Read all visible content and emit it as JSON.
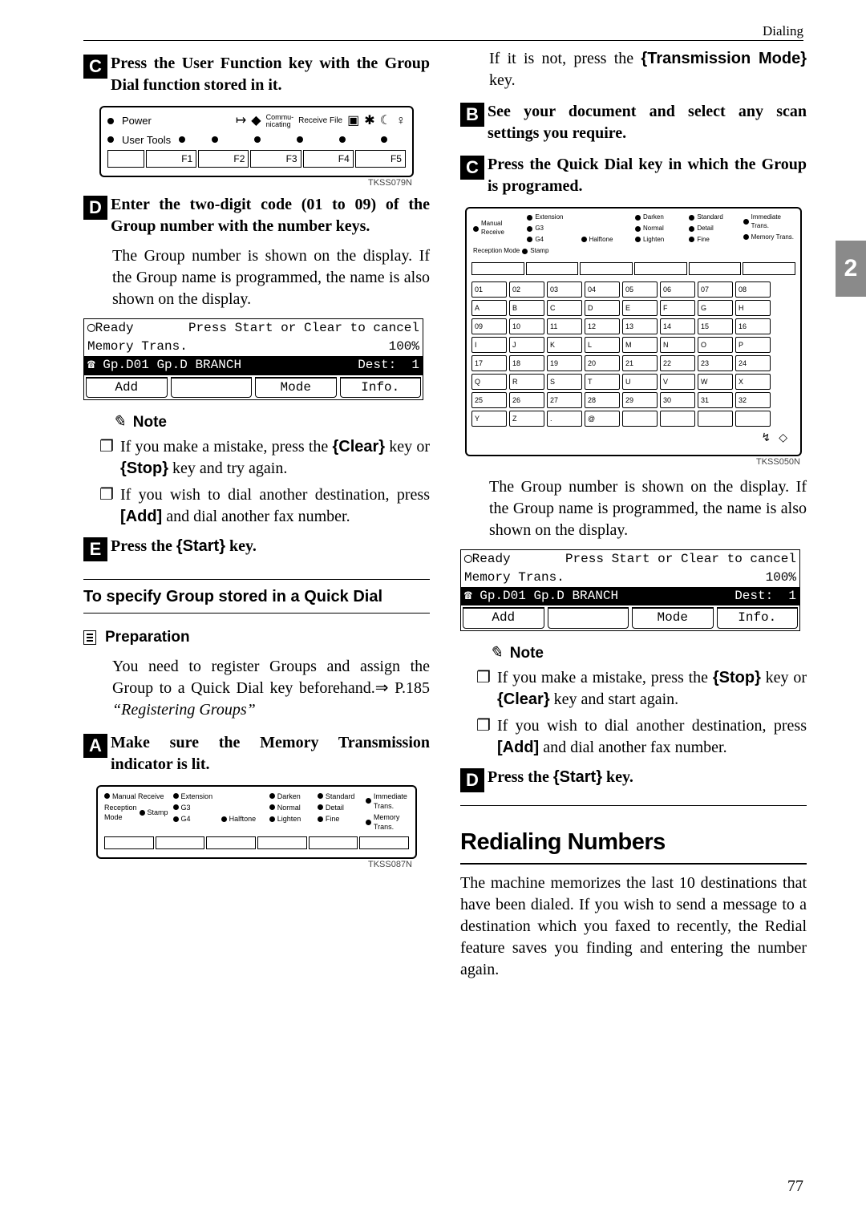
{
  "header": {
    "section": "Dialing"
  },
  "sideTab": "2",
  "pageNumber": "77",
  "left": {
    "step3": {
      "num": "C",
      "text": "Press the User Function key with the Group Dial function stored in it."
    },
    "fig1": {
      "power": "Power",
      "userTools": "User Tools",
      "commu": "Commu-",
      "nicating": "nicating",
      "receive": "Receive File",
      "f1": "F1",
      "f2": "F2",
      "f3": "F3",
      "f4": "F4",
      "f5": "F5",
      "code": "TKSS079N"
    },
    "step4": {
      "num": "D",
      "text": "Enter the two-digit code (01 to 09) of the Group number with the number keys."
    },
    "para1": "The Group number is shown on the display. If the Group name is programmed, the name is also shown on the display.",
    "lcd": {
      "line1a": "Ready",
      "line1b": "Press Start or Clear to cancel",
      "line2a": "Memory Trans.",
      "line2b": "100%",
      "line3a": "Gp.D01 Gp.D BRANCH",
      "line3b": "Dest:  1",
      "btn1": "Add",
      "btn2": "",
      "btn3": "Mode",
      "btn4": "Info."
    },
    "noteHead": "Note",
    "bullets": [
      {
        "pre": "If you make a mistake, press the ",
        "k1": "Clear",
        "mid": " key or ",
        "k2": "Stop",
        "post": " key and try again."
      },
      {
        "pre": "If you wish to dial another destination, press ",
        "k1": "[Add]",
        "post": " and dial another fax number."
      }
    ],
    "step5": {
      "num": "E",
      "pre": "Press the ",
      "key": "Start",
      "post": " key."
    },
    "subhead": "To specify Group stored in a Quick Dial",
    "prepHead": "Preparation",
    "prepBody": {
      "pre": "You need to register Groups and assign the Group to a Quick Dial key beforehand.⇒ P.185 ",
      "ital": "“Registering Groups”"
    },
    "stepA": {
      "num": "A",
      "text": "Make sure the Memory Transmission indicator is lit."
    },
    "fig2": {
      "labels": {
        "manual": "Manual Receive",
        "reception": "Reception Mode",
        "stamp": "Stamp",
        "ext": "Extension",
        "g3": "G3",
        "g4": "G4",
        "halftone": "Halftone",
        "darken": "Darken",
        "normal": "Normal",
        "lighten": "Lighten",
        "standard": "Standard",
        "detail": "Detail",
        "fine": "Fine",
        "immediate": "Immediate",
        "trans": "Trans.",
        "memory": "Memory Trans."
      },
      "code": "TKSS087N"
    }
  },
  "right": {
    "intro": {
      "pre": "If it is not, press the ",
      "key": "Transmission Mode",
      "post": " key."
    },
    "stepB": {
      "num": "B",
      "text": "See your document and select any scan settings you require."
    },
    "stepC": {
      "num": "C",
      "text": "Press the Quick Dial key in which the Group is programed."
    },
    "fig3code": "TKSS050N",
    "dialTop": {
      "manual": "Manual Receive",
      "reception": "Reception Mode",
      "stamp": "Stamp",
      "ext": "Extension",
      "g3": "G3",
      "g4": "G4",
      "halftone": "Halftone",
      "darken": "Darken",
      "normal": "Normal",
      "lighten": "Lighten",
      "standard": "Standard",
      "detail": "Detail",
      "fine": "Fine",
      "immediate": "Immediate",
      "trans": "Trans.",
      "memory": "Memory Trans."
    },
    "dialRows": [
      [
        "01",
        "02",
        "03",
        "04",
        "05",
        "06",
        "07",
        "08"
      ],
      [
        "A",
        "B",
        "C",
        "D",
        "E",
        "F",
        "G",
        "H"
      ],
      [
        "09",
        "10",
        "11",
        "12",
        "13",
        "14",
        "15",
        "16"
      ],
      [
        "I",
        "J",
        "K",
        "L",
        "M",
        "N",
        "O",
        "P"
      ],
      [
        "17",
        "18",
        "19",
        "20",
        "21",
        "22",
        "23",
        "24"
      ],
      [
        "Q",
        "R",
        "S",
        "T",
        "U",
        "V",
        "W",
        "X"
      ],
      [
        "25",
        "26",
        "27",
        "28",
        "29",
        "30",
        "31",
        "32"
      ],
      [
        "Y",
        "Z",
        ".",
        "@",
        "",
        "",
        "",
        ""
      ]
    ],
    "para1": "The Group number is shown on the display. If the Group name is programmed, the name is also shown on the display.",
    "lcd": {
      "line1a": "Ready",
      "line1b": "Press Start or Clear to cancel",
      "line2a": "Memory Trans.",
      "line2b": "100%",
      "line3a": "Gp.D01 Gp.D BRANCH",
      "line3b": "Dest:  1",
      "btn1": "Add",
      "btn2": "",
      "btn3": "Mode",
      "btn4": "Info."
    },
    "noteHead": "Note",
    "bullets": [
      {
        "pre": "If you make a mistake, press the ",
        "k1": "Stop",
        "mid": " key or ",
        "k2": "Clear",
        "post": " key and start again."
      },
      {
        "pre": "If you wish to dial another destination, press ",
        "k1": "[Add]",
        "post": " and dial another fax number."
      }
    ],
    "stepD": {
      "num": "D",
      "pre": "Press the ",
      "key": "Start",
      "post": " key."
    },
    "h2": "Redialing Numbers",
    "para2": "The machine memorizes the last 10 destinations that have been dialed. If you wish to send a message to a destination which you faxed to recently, the Redial feature saves you finding and entering the number again."
  }
}
